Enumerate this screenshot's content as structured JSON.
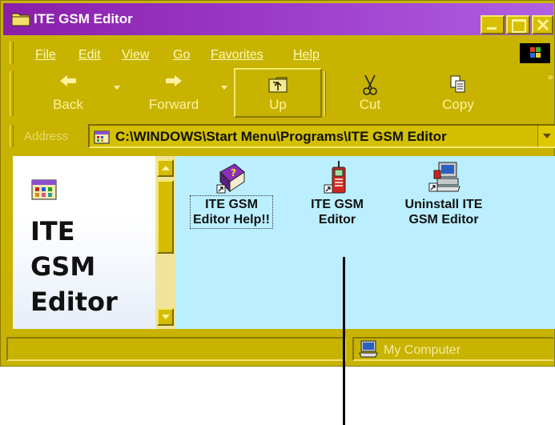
{
  "window": {
    "title": "ITE GSM Editor"
  },
  "menu": {
    "items": [
      "File",
      "Edit",
      "View",
      "Go",
      "Favorites",
      "Help"
    ]
  },
  "toolbar": {
    "back": "Back",
    "forward": "Forward",
    "up": "Up",
    "cut": "Cut",
    "copy": "Copy"
  },
  "address": {
    "label": "Address",
    "path": "C:\\WINDOWS\\Start Menu\\Programs\\ITE GSM Editor"
  },
  "left_pane": {
    "title_lines": [
      "ITE",
      "GSM",
      "Editor"
    ]
  },
  "files": [
    {
      "line1": "ITE GSM",
      "line2": "Editor Help!!",
      "icon": "help-book-shortcut-icon"
    },
    {
      "line1": "ITE GSM",
      "line2": "Editor",
      "icon": "mobile-phone-shortcut-icon"
    },
    {
      "line1": "Uninstall ITE",
      "line2": "GSM Editor",
      "icon": "computer-setup-shortcut-icon"
    }
  ],
  "status": {
    "zone": "My Computer"
  },
  "colors": {
    "chrome": "#c8b400",
    "title_gradient_start": "#8a1fa8",
    "content_bg": "#bbefff"
  }
}
